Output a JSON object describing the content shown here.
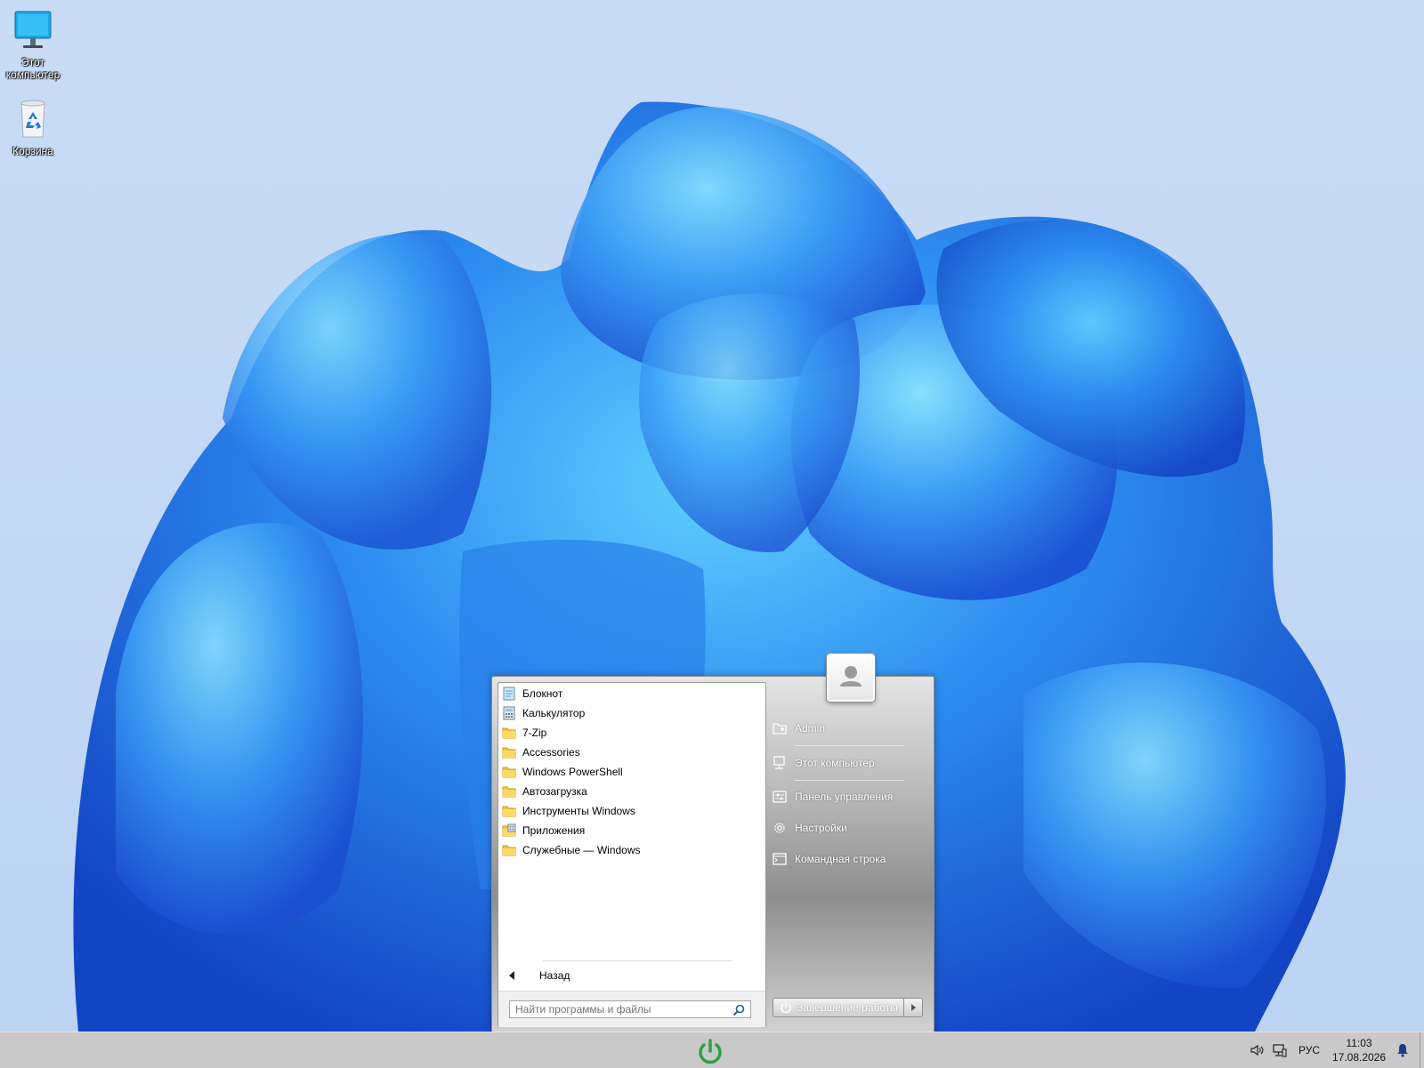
{
  "desktop": {
    "icons": [
      {
        "label": "Этот компьютер",
        "icon": "monitor-icon"
      },
      {
        "label": "Корзина",
        "icon": "recycle-bin-icon"
      }
    ]
  },
  "start_menu": {
    "programs": [
      {
        "label": "Блокнот",
        "icon": "notepad-icon"
      },
      {
        "label": "Калькулятор",
        "icon": "calculator-icon"
      },
      {
        "label": "7-Zip",
        "icon": "folder-icon"
      },
      {
        "label": "Accessories",
        "icon": "folder-icon"
      },
      {
        "label": "Windows PowerShell",
        "icon": "folder-icon"
      },
      {
        "label": "Автозагрузка",
        "icon": "folder-icon"
      },
      {
        "label": "Инструменты Windows",
        "icon": "folder-icon"
      },
      {
        "label": "Приложения",
        "icon": "apps-folder-icon"
      },
      {
        "label": "Служебные — Windows",
        "icon": "folder-icon"
      }
    ],
    "back_label": "Назад",
    "search_placeholder": "Найти программы и файлы",
    "right_items": [
      {
        "label": "Admin",
        "icon": "user-folder-icon"
      },
      {
        "label": "Этот компьютер",
        "icon": "computer-icon"
      },
      {
        "label": "Панель управления",
        "icon": "control-panel-icon"
      },
      {
        "label": "Настройки",
        "icon": "gear-icon"
      },
      {
        "label": "Командная строка",
        "icon": "command-prompt-icon"
      }
    ],
    "shutdown_label": "Завершение работы"
  },
  "taskbar": {
    "language": "РУС",
    "time": "11:03",
    "date": "17.08.2026"
  },
  "colors": {
    "wallpaper_bg": "#c6dbf7",
    "flower_blue": "#1e73e6",
    "taskbar": "#c9c9c9",
    "start_button_green": "#2ea043"
  }
}
